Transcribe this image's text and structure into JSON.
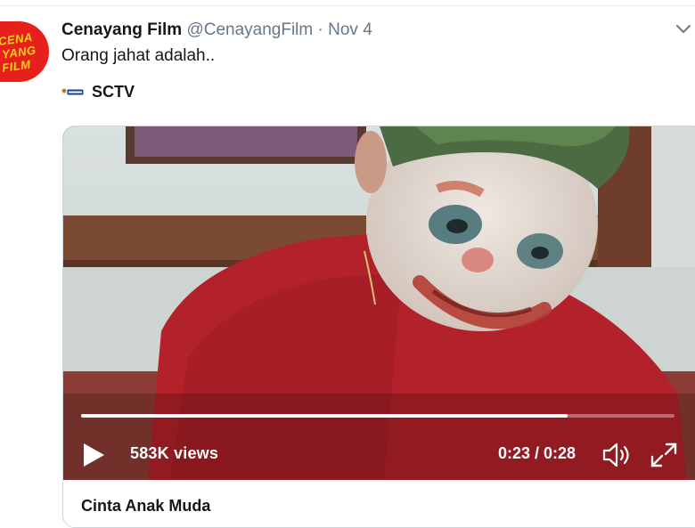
{
  "tweet": {
    "author_name": "Cenayang Film",
    "handle": "@CenayangFilm",
    "separator": "·",
    "date": "Nov 4",
    "text": "Orang jahat adalah..",
    "avatar_lines": [
      "CENA",
      "YANG",
      "FILM"
    ],
    "avatar_colors": {
      "background": "#e8201c",
      "text": "#ffd21a"
    },
    "more_icon": "chevron-down-icon"
  },
  "source": {
    "name": "SCTV",
    "icon": "sctv-logo-icon"
  },
  "video": {
    "progress": 0.82,
    "views": "583K views",
    "time": "0:23 / 0:28",
    "play_icon": "play-icon",
    "volume_icon": "volume-icon",
    "fullscreen_icon": "fullscreen-icon"
  },
  "card": {
    "title": "Cinta Anak Muda"
  },
  "colors": {
    "text_primary": "#14171a",
    "text_secondary": "#657786",
    "border": "#ccd6dd"
  }
}
